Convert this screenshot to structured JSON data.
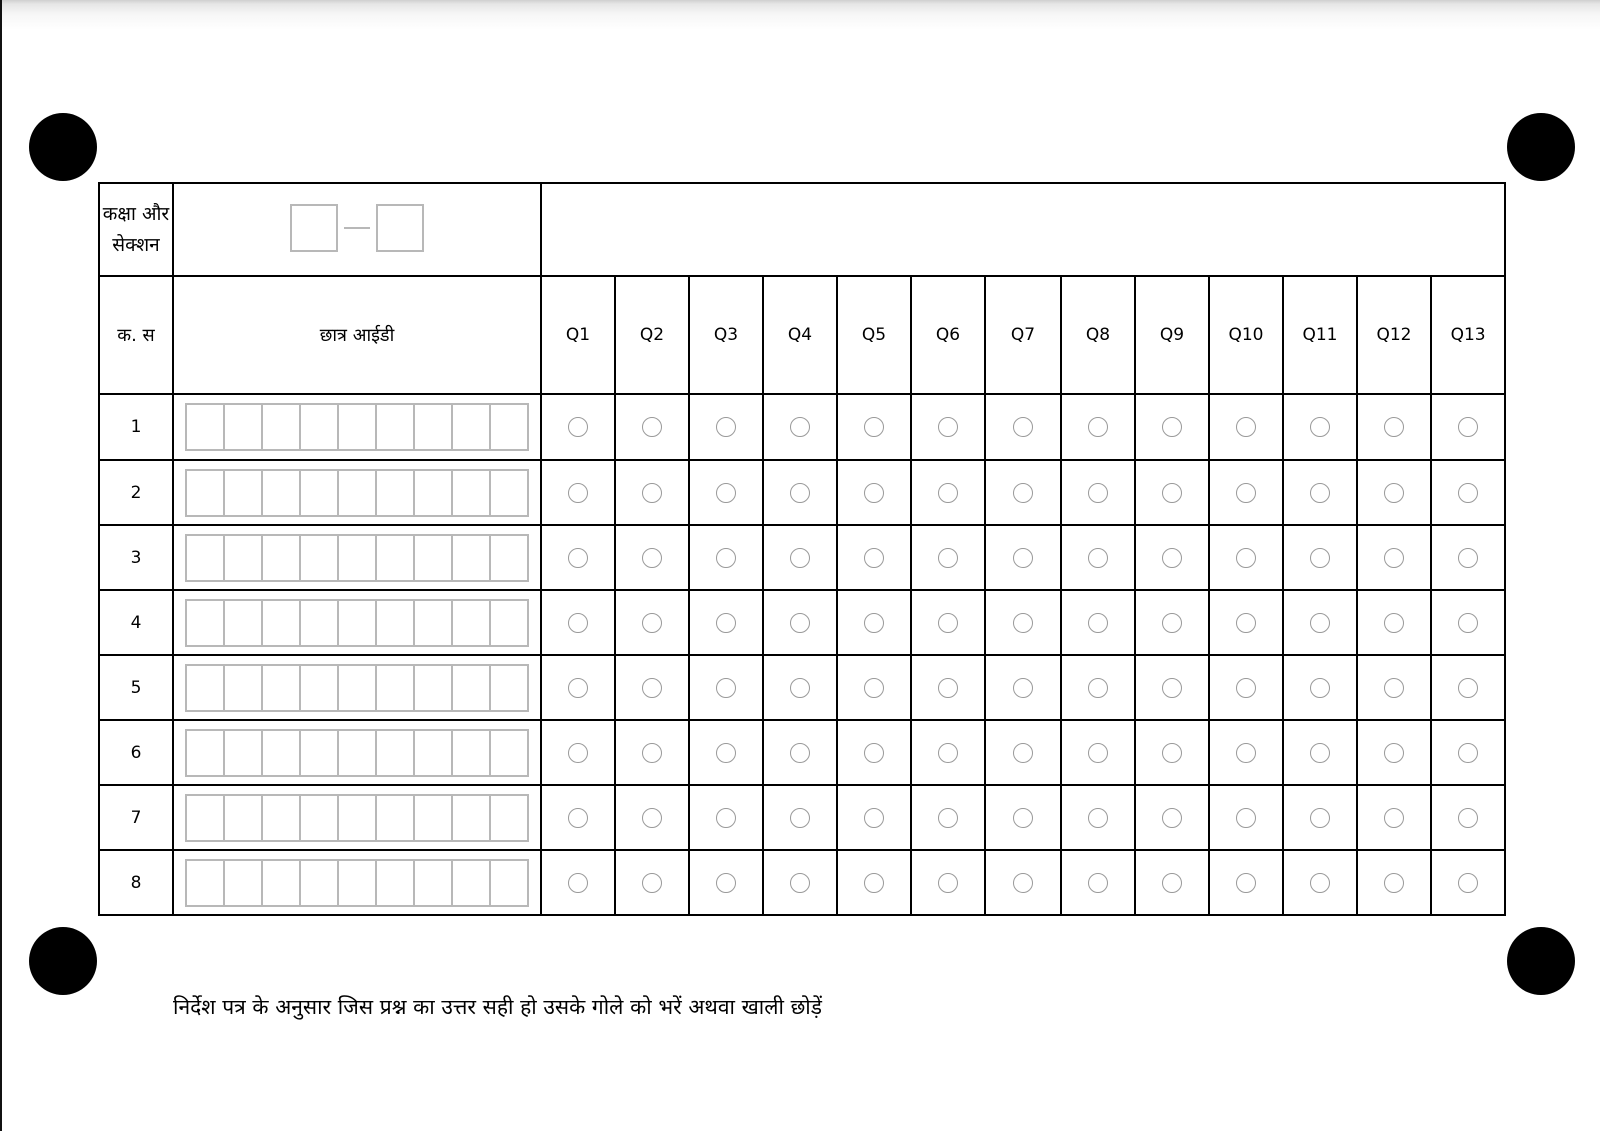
{
  "form": {
    "class_section_label": [
      "कक्षा और",
      "सेक्शन"
    ],
    "serial_header": "क. स",
    "student_id_header": "छात्र आईडी",
    "id_box_count": 9,
    "question_headers": [
      "Q1",
      "Q2",
      "Q3",
      "Q4",
      "Q5",
      "Q6",
      "Q7",
      "Q8",
      "Q9",
      "Q10",
      "Q11",
      "Q12",
      "Q13"
    ],
    "rows": [
      "1",
      "2",
      "3",
      "4",
      "5",
      "6",
      "7",
      "8"
    ]
  },
  "instruction": "निर्देश पत्र के अनुसार जिस प्रश्न का उत्तर सही हो उसके गोले को भरें अथवा खाली छोड़ें"
}
